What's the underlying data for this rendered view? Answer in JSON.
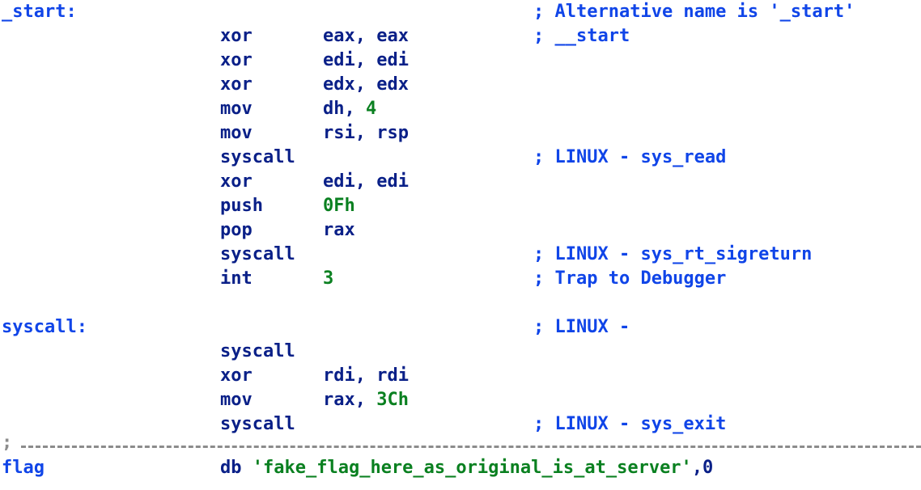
{
  "view": {
    "kind": "disassembly-listing",
    "colors": {
      "background": "#ffffff",
      "label": "#1045e8",
      "comment": "#1045e8",
      "mnemonic": "#0a2088",
      "operand": "#0a2088",
      "immediate": "#0a8020",
      "string": "#0a8020",
      "separator": "#8c8c8c"
    }
  },
  "lines": [
    {
      "type": "label",
      "label": "_start:",
      "mnemonic": "",
      "operands": "",
      "immediate": "",
      "comment": "; Alternative name is '_start'"
    },
    {
      "type": "instruction",
      "label": "",
      "mnemonic": "xor",
      "operands": "eax, eax",
      "immediate": "",
      "comment": "; __start"
    },
    {
      "type": "instruction",
      "label": "",
      "mnemonic": "xor",
      "operands": "edi, edi",
      "immediate": "",
      "comment": ""
    },
    {
      "type": "instruction",
      "label": "",
      "mnemonic": "xor",
      "operands": "edx, edx",
      "immediate": "",
      "comment": ""
    },
    {
      "type": "instruction-imm",
      "label": "",
      "mnemonic": "mov",
      "operands": "dh, ",
      "immediate": "4",
      "comment": ""
    },
    {
      "type": "instruction",
      "label": "",
      "mnemonic": "mov",
      "operands": "rsi, rsp",
      "immediate": "",
      "comment": ""
    },
    {
      "type": "instruction",
      "label": "",
      "mnemonic": "syscall",
      "operands": "",
      "immediate": "",
      "comment": "; LINUX - sys_read"
    },
    {
      "type": "instruction",
      "label": "",
      "mnemonic": "xor",
      "operands": "edi, edi",
      "immediate": "",
      "comment": ""
    },
    {
      "type": "instruction-imm",
      "label": "",
      "mnemonic": "push",
      "operands": "",
      "immediate": "0Fh",
      "comment": ""
    },
    {
      "type": "instruction",
      "label": "",
      "mnemonic": "pop",
      "operands": "rax",
      "immediate": "",
      "comment": ""
    },
    {
      "type": "instruction",
      "label": "",
      "mnemonic": "syscall",
      "operands": "",
      "immediate": "",
      "comment": "; LINUX - sys_rt_sigreturn"
    },
    {
      "type": "instruction-imm",
      "label": "",
      "mnemonic": "int",
      "operands": "",
      "immediate": "3",
      "comment": "; Trap to Debugger"
    },
    {
      "type": "blank",
      "label": "",
      "mnemonic": "",
      "operands": "",
      "immediate": "",
      "comment": ""
    },
    {
      "type": "label",
      "label": "syscall:",
      "mnemonic": "",
      "operands": "",
      "immediate": "",
      "comment": "; LINUX -"
    },
    {
      "type": "instruction",
      "label": "",
      "mnemonic": "syscall",
      "operands": "",
      "immediate": "",
      "comment": ""
    },
    {
      "type": "instruction",
      "label": "",
      "mnemonic": "xor",
      "operands": "rdi, rdi",
      "immediate": "",
      "comment": ""
    },
    {
      "type": "instruction-imm",
      "label": "",
      "mnemonic": "mov",
      "operands": "rax, ",
      "immediate": "3Ch",
      "comment": ""
    },
    {
      "type": "instruction",
      "label": "",
      "mnemonic": "syscall",
      "operands": "",
      "immediate": "",
      "comment": "; LINUX - sys_exit"
    }
  ],
  "separator": {
    "semicolon": ";"
  },
  "data_lines": [
    {
      "label": "flag",
      "mnemonic": "db",
      "string": "'fake_flag_here_as_original_is_at_server'",
      "suffix": ",0"
    }
  ]
}
